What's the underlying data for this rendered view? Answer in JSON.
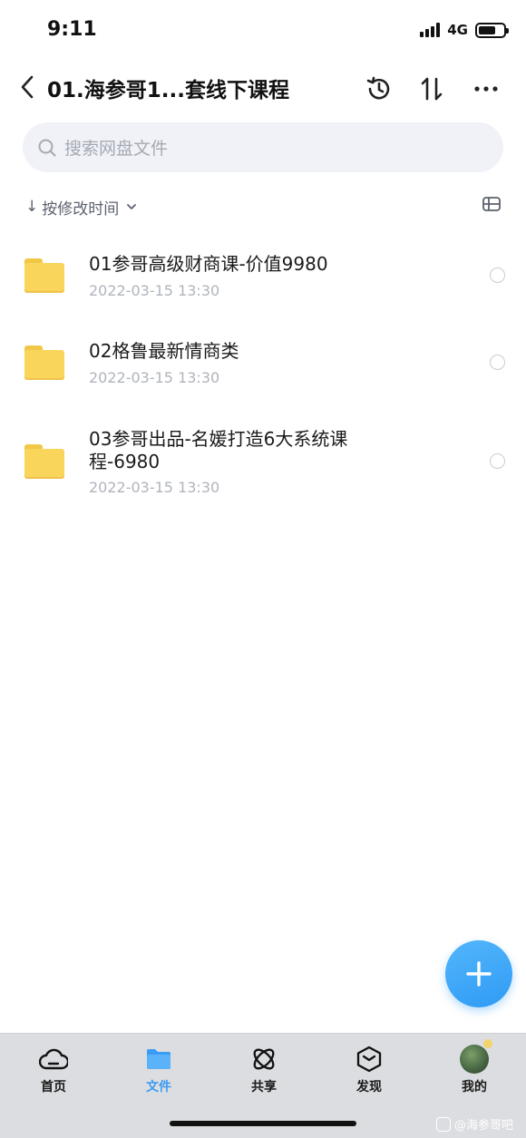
{
  "status": {
    "time": "9:11",
    "network": "4G"
  },
  "nav": {
    "title": "01.海参哥1...套线下课程"
  },
  "search": {
    "placeholder": "搜索网盘文件"
  },
  "sort": {
    "label": "按修改时间"
  },
  "files": [
    {
      "name": "01参哥高级财商课-价值9980",
      "date": "2022-03-15 13:30"
    },
    {
      "name": "02格鲁最新情商类",
      "date": "2022-03-15 13:30"
    },
    {
      "name": "03参哥出品-名媛打造6大系统课程-6980",
      "date": "2022-03-15 13:30"
    }
  ],
  "tabs": [
    {
      "label": "首页",
      "icon": "cloud-icon"
    },
    {
      "label": "文件",
      "icon": "folder-icon",
      "active": true
    },
    {
      "label": "共享",
      "icon": "share-orbit-icon"
    },
    {
      "label": "发现",
      "icon": "discover-cube-icon"
    },
    {
      "label": "我的",
      "icon": "avatar"
    }
  ],
  "watermark": {
    "text": "@海参哥吧"
  },
  "colors": {
    "accent": "#3a9cf4",
    "folder": "#f9d55b",
    "tab_bar_bg": "#dcdde0"
  }
}
